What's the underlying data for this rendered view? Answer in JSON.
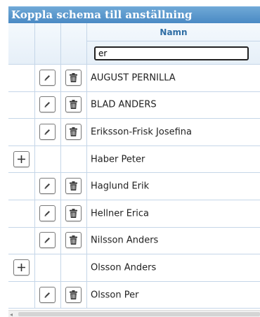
{
  "title": "Koppla schema till anställning",
  "columns": {
    "name_header": "Namn"
  },
  "filter": {
    "value": "er"
  },
  "rows": [
    {
      "name": "AUGUST PERNILLA",
      "actions": [
        "edit",
        "delete"
      ]
    },
    {
      "name": "BLAD ANDERS",
      "actions": [
        "edit",
        "delete"
      ]
    },
    {
      "name": "Eriksson-Frisk Josefina",
      "actions": [
        "edit",
        "delete"
      ]
    },
    {
      "name": "Haber Peter",
      "actions": [
        "add"
      ]
    },
    {
      "name": "Haglund Erik",
      "actions": [
        "edit",
        "delete"
      ]
    },
    {
      "name": "Hellner Erica",
      "actions": [
        "edit",
        "delete"
      ]
    },
    {
      "name": "Nilsson Anders",
      "actions": [
        "edit",
        "delete"
      ]
    },
    {
      "name": "Olsson Anders",
      "actions": [
        "add"
      ]
    },
    {
      "name": "Olsson Per",
      "actions": [
        "edit",
        "delete"
      ]
    }
  ],
  "icons": {
    "add": "plus-icon",
    "edit": "pencil-icon",
    "delete": "trash-icon"
  },
  "colors": {
    "title_bar": "#4a8ac4",
    "header_text": "#2e6da4",
    "grid_line": "#c5d6e8"
  }
}
